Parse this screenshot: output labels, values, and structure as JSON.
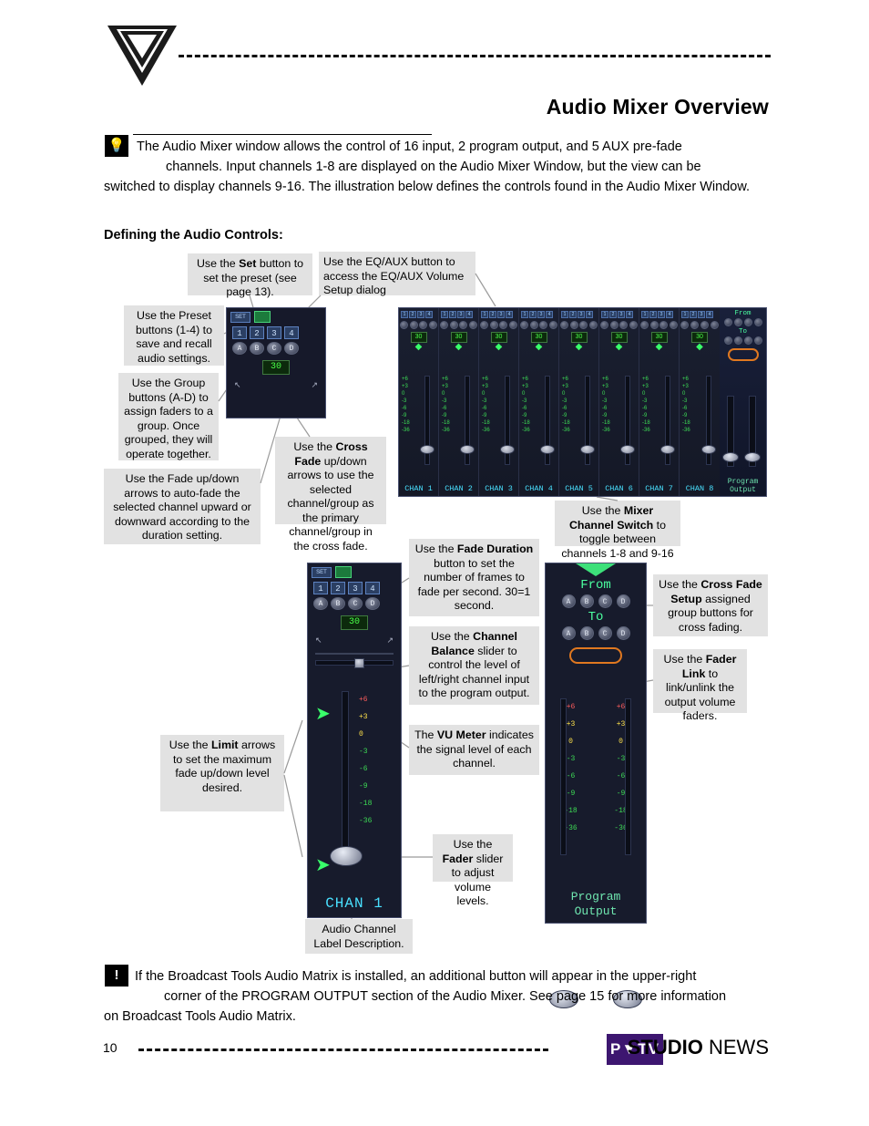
{
  "header": {
    "title": "Audio Mixer Overview"
  },
  "intro": {
    "icon": "lightbulb-icon",
    "line1": "The Audio Mixer window allows the control of 16 input, 2 program output, and 5 AUX pre-fade",
    "line2": "channels.  Input channels 1-8 are displayed on the Audio Mixer Window, but the view can be",
    "line3": "switched to display channels 9-16.  The illustration below defines the controls found in the Audio Mixer",
    "line4": "Window."
  },
  "subhead": "Defining the Audio Controls:",
  "callouts": {
    "set": {
      "pre": "Use the ",
      "bold": "Set",
      "post": " button to set the preset (see page 13)."
    },
    "eqaux": {
      "text": "Use the EQ/AUX button to access the EQ/AUX Volume Setup dialog"
    },
    "preset": {
      "text": "Use the Preset buttons (1-4) to save and recall audio settings."
    },
    "group": {
      "text": "Use the Group buttons (A-D) to assign faders to a group.  Once grouped, they will operate together."
    },
    "fade": {
      "text": "Use the Fade up/down arrows to auto-fade the selected channel upward or downward according to the duration setting."
    },
    "crossfade": {
      "pre": "Use the ",
      "bold": "Cross Fade",
      "post": " up/down arrows to use the selected channel/group as the primary channel/group in the cross fade."
    },
    "mixerswitch": {
      "pre": "Use the ",
      "bold": "Mixer Channel Switch",
      "post": " to toggle between channels 1-8 and 9-16"
    },
    "faderduration": {
      "pre": "Use the ",
      "bold": "Fade Duration",
      "post": " button to set the number of frames to fade per second. 30=1 second."
    },
    "channelbalance": {
      "pre": "Use the ",
      "bold": "Channel Balance",
      "post": " slider to control the level of left/right channel input to the program output."
    },
    "vumeter": {
      "pre": "The ",
      "bold": "VU Meter",
      "post": " indicates the signal level of each channel."
    },
    "limit": {
      "pre": "Use the ",
      "bold": "Limit",
      "post": " arrows to set the maximum fade up/down level desired."
    },
    "fader": {
      "pre": "Use the ",
      "bold": "Fader",
      "post": " slider to adjust volume levels."
    },
    "crossfadesetup": {
      "pre": "Use the ",
      "bold": "Cross  Fade Setup",
      "post": " assigned group buttons for cross fading."
    },
    "faderlink": {
      "pre": "Use the ",
      "bold": "Fader Link",
      "post": " to link/unlink the output volume faders."
    },
    "audiochannel": {
      "text": "Audio Channel Label Description."
    }
  },
  "mixer": {
    "preset_panel": {
      "set_label": "SET",
      "eq_icon": "eq-aux-button",
      "presets": [
        "1",
        "2",
        "3",
        "4"
      ],
      "groups": [
        "A",
        "B",
        "C",
        "D"
      ],
      "duration": "30",
      "xf_left": "↖",
      "xf_right": "↗"
    },
    "channel_strips": [
      {
        "label": "CHAN 1",
        "preset_nums": [
          "1",
          "2",
          "3",
          "4"
        ],
        "duration": "30"
      },
      {
        "label": "CHAN 2",
        "preset_nums": [
          "1",
          "2",
          "3",
          "4"
        ],
        "duration": "30"
      },
      {
        "label": "CHAN 3",
        "preset_nums": [
          "1",
          "2",
          "3",
          "4"
        ],
        "duration": "30"
      },
      {
        "label": "CHAN 4",
        "preset_nums": [
          "1",
          "2",
          "3",
          "4"
        ],
        "duration": "30"
      },
      {
        "label": "CHAN 5",
        "preset_nums": [
          "1",
          "2",
          "3",
          "4"
        ],
        "duration": "30"
      },
      {
        "label": "CHAN 6",
        "preset_nums": [
          "1",
          "2",
          "3",
          "4"
        ],
        "duration": "30"
      },
      {
        "label": "CHAN 7",
        "preset_nums": [
          "1",
          "2",
          "3",
          "4"
        ],
        "duration": "30"
      },
      {
        "label": "CHAN 8",
        "preset_nums": [
          "1",
          "2",
          "3",
          "4"
        ],
        "duration": "30"
      }
    ],
    "output_strip": {
      "from_label": "From",
      "to_label": "To",
      "program_label": "Program",
      "output_label": "Output"
    },
    "big_channel": {
      "set_label": "SET",
      "presets": [
        "1",
        "2",
        "3",
        "4"
      ],
      "groups": [
        "A",
        "B",
        "C",
        "D"
      ],
      "duration": "30",
      "vu_ticks": [
        "+6",
        "+3",
        "0",
        "-3",
        "-6",
        "-9",
        "-18",
        "-36"
      ],
      "label": "CHAN 1"
    },
    "program_panel": {
      "from_label": "From",
      "to_label": "To",
      "groups_from": [
        "A",
        "B",
        "C",
        "D"
      ],
      "groups_to": [
        "A",
        "B",
        "C",
        "D"
      ],
      "vu_ticks": [
        "+6",
        "+3",
        "0",
        "-3",
        "-6",
        "-9",
        "-18",
        "-36"
      ],
      "label_line1": "Program",
      "label_line2": "Output"
    },
    "scale_ticks": [
      "+6",
      "+3",
      "0",
      "-3",
      "-6",
      "-9",
      "-18",
      "-36"
    ]
  },
  "warning": {
    "icon": "exclamation-icon",
    "line1": "If the Broadcast Tools Audio Matrix is installed, an additional button will appear in the upper-right",
    "line2": "corner of the PROGRAM OUTPUT section of the Audio Mixer.  See page 15 for more information",
    "line3": "on Broadcast Tools Audio Matrix."
  },
  "footer": {
    "page_number": "10",
    "logo_text": "P▼TV",
    "brand_bold": "STUDIO",
    "brand_light": " NEWS"
  },
  "colors": {
    "accent_green": "#3de07a",
    "callout_bg": "#e2e2e2",
    "mixer_bg": "#141826",
    "logo_purple": "#3d1670"
  }
}
